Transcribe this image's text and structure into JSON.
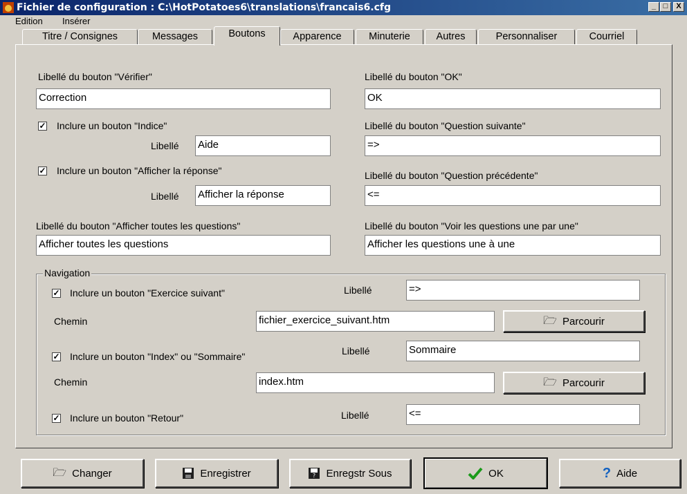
{
  "window": {
    "title": "Fichier de configuration : C:\\HotPotatoes6\\translations\\francais6.cfg",
    "controls": {
      "minimize": "_",
      "maximize": "□",
      "close": "X"
    }
  },
  "menu": {
    "edition": "Edition",
    "inserer": "Insérer"
  },
  "tabs": [
    "Titre / Consignes",
    "Messages",
    "Boutons",
    "Apparence",
    "Minuterie",
    "Autres",
    "Personnaliser",
    "Courriel"
  ],
  "active_tab": "Boutons",
  "form": {
    "verifier_label": "Libellé du bouton \"Vérifier\"",
    "verifier_value": "Correction",
    "ok_label": "Libellé du bouton \"OK\"",
    "ok_value": "OK",
    "indice_check": "Inclure un bouton \"Indice\"",
    "indice_libelle": "Libellé",
    "indice_value": "Aide",
    "question_suivante_label": "Libellé du bouton \"Question suivante\"",
    "question_suivante_value": "=>",
    "afficher_reponse_check": "Inclure un bouton \"Afficher la réponse\"",
    "afficher_reponse_libelle": "Libellé",
    "afficher_reponse_value": "Afficher la réponse",
    "question_precedente_label": "Libellé du bouton \"Question précédente\"",
    "question_precedente_value": "<=",
    "toutes_questions_label": "Libellé du bouton \"Afficher toutes les questions\"",
    "toutes_questions_value": "Afficher toutes les questions",
    "une_par_une_label": "Libellé du bouton \"Voir les questions une par une\"",
    "une_par_une_value": "Afficher les questions une à une"
  },
  "navigation": {
    "title": "Navigation",
    "exercice_check": "Inclure un bouton \"Exercice suivant\"",
    "exercice_libelle": "Libellé",
    "exercice_value": "=>",
    "chemin1_label": "Chemin",
    "chemin1_value": "fichier_exercice_suivant.htm",
    "parcourir1": "Parcourir",
    "index_check": "Inclure un bouton \"Index\" ou \"Sommaire\"",
    "index_libelle": "Libellé",
    "index_value": "Sommaire",
    "chemin2_label": "Chemin",
    "chemin2_value": "index.htm",
    "parcourir2": "Parcourir",
    "retour_check": "Inclure un bouton \"Retour\"",
    "retour_libelle": "Libellé",
    "retour_value": "<="
  },
  "buttons": {
    "changer": "Changer",
    "enregistrer": "Enregistrer",
    "enregistrer_sous": "Enregstr Sous",
    "ok": "OK",
    "aide": "Aide"
  },
  "checkmark": "✓",
  "icons": {
    "folder": "folder-open-icon",
    "save": "floppy-disk-icon",
    "save_as": "save-as-icon",
    "ok": "green-check-icon",
    "help": "help-question-icon"
  },
  "colors": {
    "titlebar": "#0a246a",
    "face": "#d4d0c8",
    "ok_check": "#1a9a1a",
    "help": "#1060c0"
  }
}
